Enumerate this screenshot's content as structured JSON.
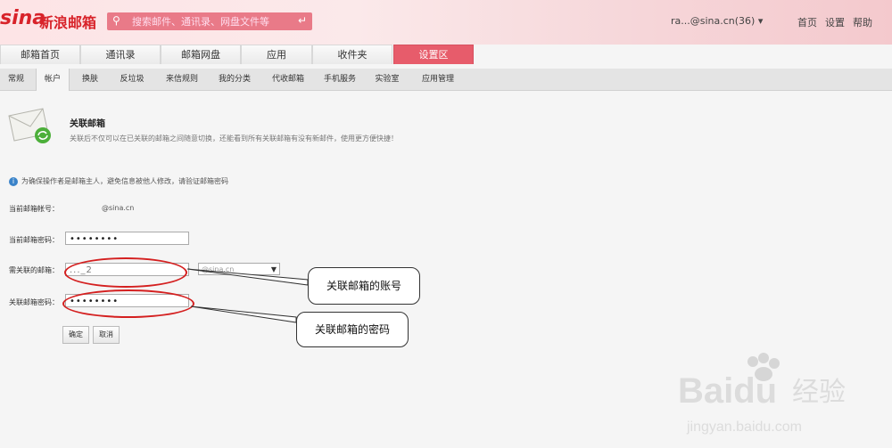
{
  "header": {
    "logo_text": "sina",
    "logo_cn": "新浪邮箱",
    "search_placeholder": "搜索邮件、通讯录、网盘文件等",
    "account": "ra...@sina.cn(36)",
    "links": [
      "首页",
      "设置",
      "帮助"
    ]
  },
  "main_tabs": [
    "邮箱首页",
    "通讯录",
    "邮箱网盘",
    "应用",
    "收件夹",
    "设置区"
  ],
  "sub_tabs": [
    "常规",
    "帐户",
    "换肤",
    "反垃圾",
    "来信规则",
    "我的分类",
    "代收邮箱",
    "手机服务",
    "实验室",
    "应用管理"
  ],
  "section": {
    "title": "关联邮箱",
    "desc": "关联后不仅可以在已关联的邮箱之间随意切换，还能看到所有关联邮箱有没有新邮件，使用更方便快捷！"
  },
  "info": "为确保操作者是邮箱主人，避免信息被他人修改，请验证邮箱密码",
  "form": {
    "current_account_label": "当前邮箱帐号：",
    "current_account_value": "@sina.cn",
    "current_password_label": "当前邮箱密码：",
    "current_password_value": "••••••••",
    "link_account_label": "需关联的邮箱：",
    "link_account_value": "..._2",
    "domain_value": "@sina.cn",
    "link_password_label": "关联邮箱密码：",
    "link_password_value": "••••••••",
    "confirm": "确定",
    "cancel": "取消"
  },
  "callouts": [
    "关联邮箱的账号",
    "关联邮箱的密码"
  ],
  "watermark": {
    "brand": "Baidu",
    "cn": "经验",
    "url": "jingyan.baidu.com"
  }
}
